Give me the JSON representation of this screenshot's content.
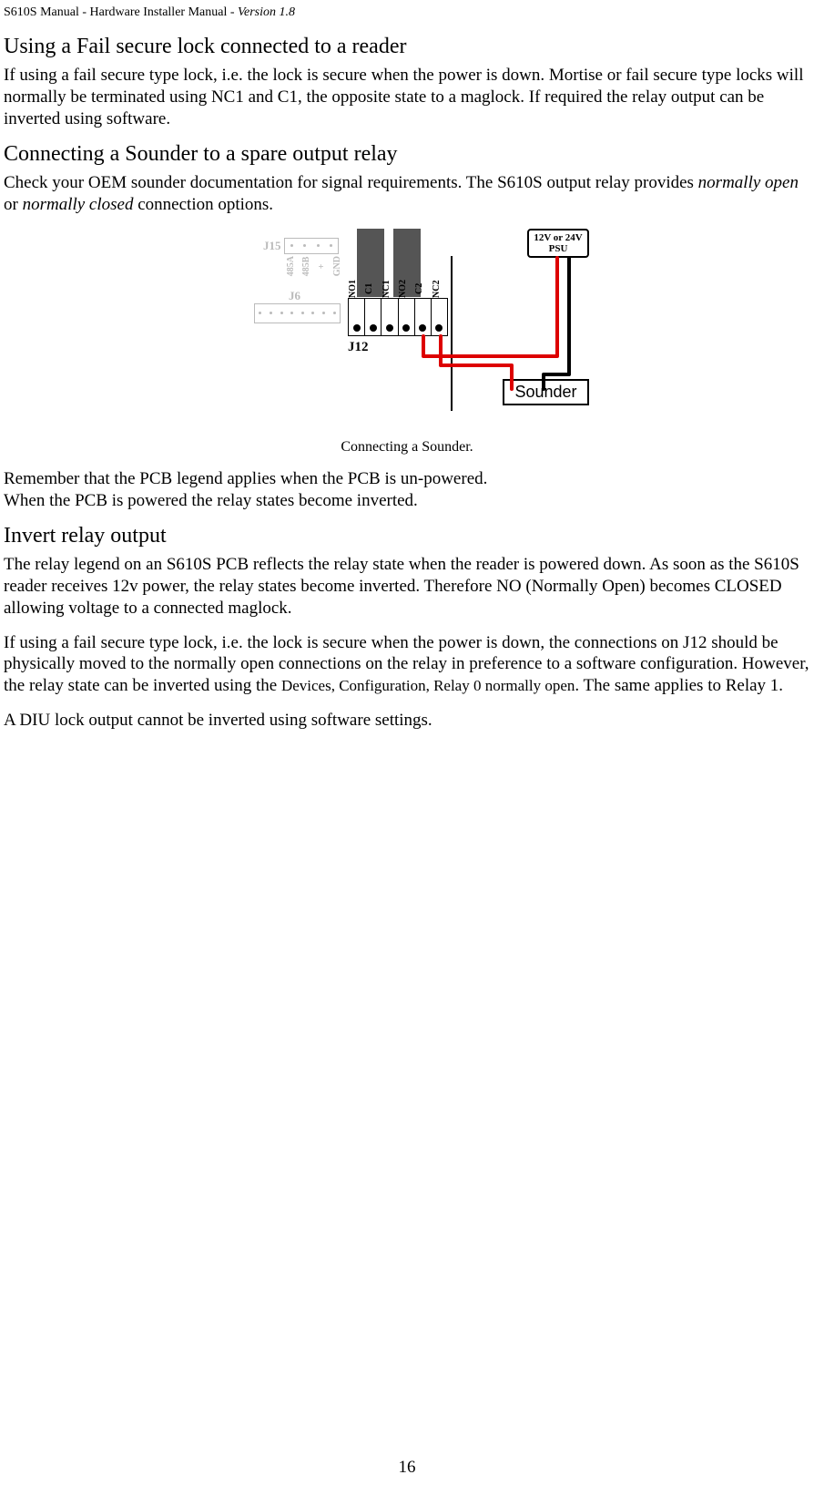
{
  "header": {
    "product": "S610S Manual",
    "subtitle": "Hardware Installer Manual",
    "version_label": "Version 1.8"
  },
  "section1": {
    "title": "Using a Fail secure lock connected to a reader",
    "p1": "If using a fail secure type lock, i.e. the lock is secure when the power is down.  Mortise or fail secure type locks will normally be terminated using NC1 and C1, the opposite state to a maglock.  If required the relay output can be inverted using software."
  },
  "section2": {
    "title": "Connecting a Sounder to a spare output relay",
    "p1_a": "Check your OEM sounder documentation for signal requirements.  The S610S output relay provides ",
    "p1_no": "normally open",
    "p1_or": " or ",
    "p1_nc": "normally closed",
    "p1_b": "  connection options."
  },
  "diagram": {
    "j15": "J15",
    "j6": "J6",
    "j12": "J12",
    "vlabels": [
      "485A",
      "485B",
      "+",
      "GND"
    ],
    "tlabels": [
      "NO1",
      "C1",
      "NC1",
      "NO2",
      "C2",
      "NC2"
    ],
    "psu": "12V or 24V PSU",
    "sounder": "Sounder"
  },
  "caption": "Connecting a Sounder.",
  "section2b": {
    "p2": "Remember that the PCB legend applies when the PCB is un-powered.",
    "p3": "When the PCB is powered the relay states become inverted."
  },
  "section3": {
    "title": "Invert relay output",
    "p1": "The relay legend on an S610S PCB reflects the relay state when the reader is powered down.  As soon as the S610S reader receives 12v power, the relay states become inverted.  Therefore NO (Normally Open) becomes CLOSED allowing voltage to a connected maglock.",
    "p2_a": "If using a fail secure type lock, i.e. the lock is secure when the power is down, the connections on J12 should be physically moved to the normally open connections on the relay in preference to a software configuration.  However, the relay state can be inverted using the ",
    "p2_menu": "Devices, Configuration, Relay 0 normally open",
    "p2_b": ". The same applies to Relay 1.",
    "p3": "A DIU lock output cannot be inverted using software settings."
  },
  "page_number": "16"
}
